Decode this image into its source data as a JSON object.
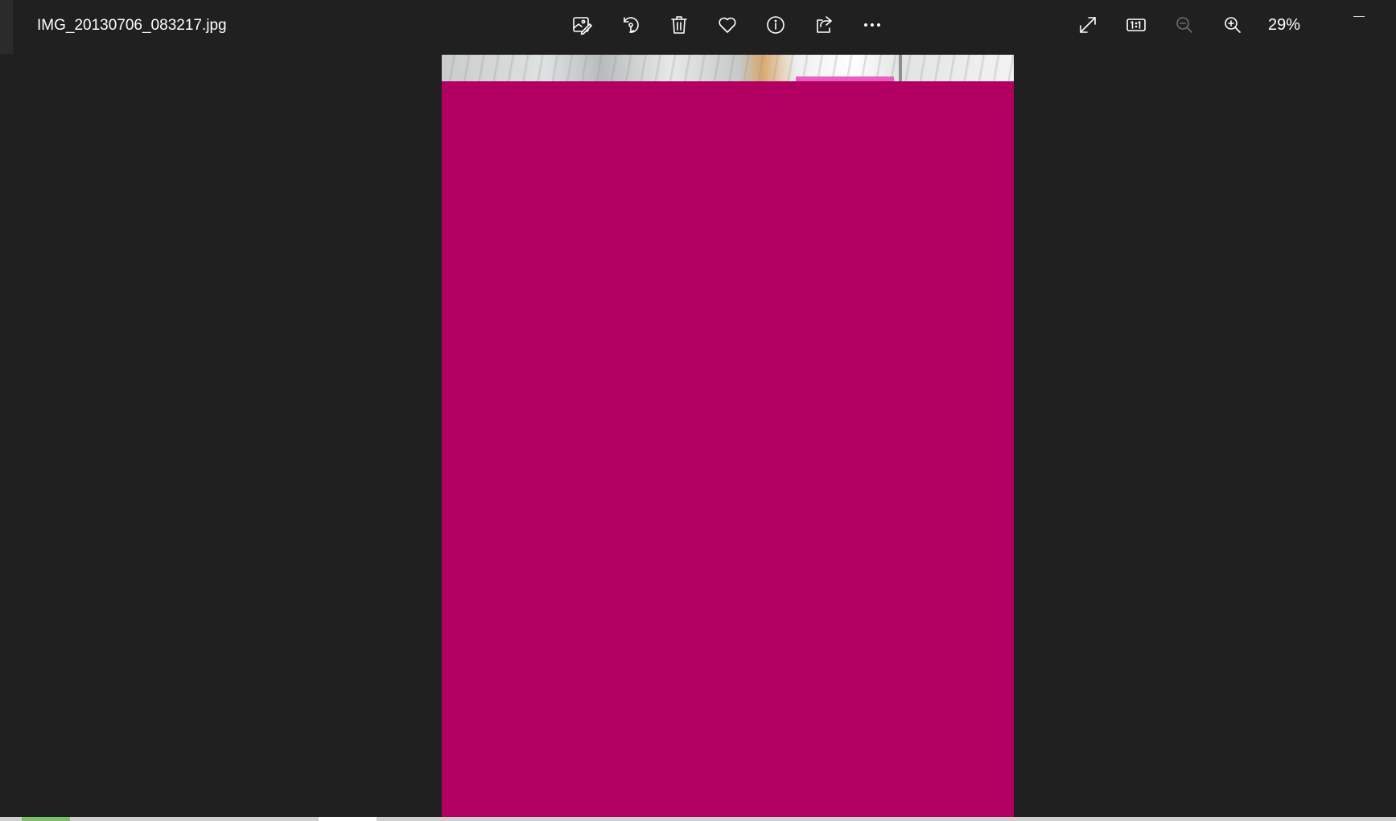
{
  "window": {
    "file_name": "IMG_20130706_083217.jpg"
  },
  "toolbar": {
    "left_actions": [
      {
        "name": "edit-image-button",
        "icon": "edit-image-icon"
      },
      {
        "name": "rotate-button",
        "icon": "rotate-icon"
      },
      {
        "name": "delete-button",
        "icon": "trash-icon"
      },
      {
        "name": "favorite-button",
        "icon": "heart-icon"
      },
      {
        "name": "info-button",
        "icon": "info-icon"
      },
      {
        "name": "share-button",
        "icon": "share-icon"
      },
      {
        "name": "more-button",
        "icon": "more-ellipsis-icon"
      }
    ],
    "right_actions": [
      {
        "name": "fullscreen-button",
        "icon": "expand-icon"
      },
      {
        "name": "actual-size-button",
        "icon": "one-to-one-icon",
        "label": "1:1"
      },
      {
        "name": "zoom-out-button",
        "icon": "zoom-out-icon",
        "disabled": true
      },
      {
        "name": "zoom-in-button",
        "icon": "zoom-in-icon"
      }
    ],
    "zoom_level": "29%"
  },
  "viewer": {
    "photo_color": "#b10062",
    "background_color": "#202020"
  }
}
